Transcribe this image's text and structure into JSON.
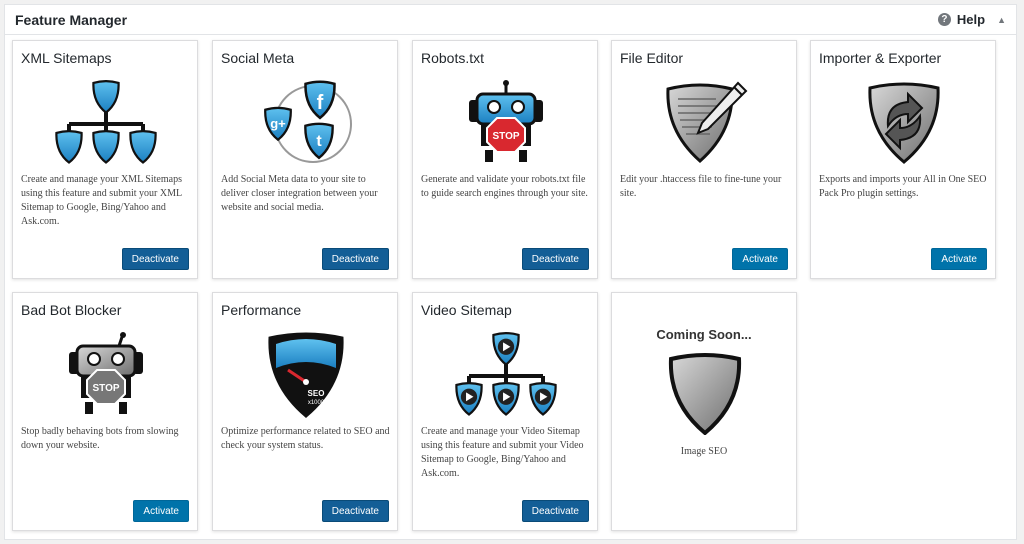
{
  "header": {
    "title": "Feature Manager",
    "help_label": "Help",
    "help_icon_glyph": "?",
    "collapse_glyph": "▲"
  },
  "cards": [
    {
      "title": "XML Sitemaps",
      "icon": "sitemap-icon",
      "description": "Create and manage your XML Sitemaps using this feature and submit your XML Sitemap to Google, Bing/Yahoo and Ask.com.",
      "button": "Deactivate"
    },
    {
      "title": "Social Meta",
      "icon": "social-meta-icon",
      "description": "Add Social Meta data to your site to deliver closer integration between your website and social media.",
      "button": "Deactivate"
    },
    {
      "title": "Robots.txt",
      "icon": "robot-icon",
      "description": "Generate and validate your robots.txt file to guide search engines through your site.",
      "button": "Deactivate",
      "icon_text": "STOP"
    },
    {
      "title": "File Editor",
      "icon": "file-editor-icon",
      "description": "Edit your .htaccess file to fine-tune your site.",
      "button": "Activate"
    },
    {
      "title": "Importer & Exporter",
      "icon": "import-export-icon",
      "description": "Exports and imports your All in One SEO Pack Pro plugin settings.",
      "button": "Activate"
    },
    {
      "title": "Bad Bot Blocker",
      "icon": "bad-bot-icon",
      "description": "Stop badly behaving bots from slowing down your website.",
      "button": "Activate",
      "icon_text": "STOP"
    },
    {
      "title": "Performance",
      "icon": "performance-gauge-icon",
      "description": "Optimize performance related to SEO and check your system status.",
      "button": "Deactivate",
      "icon_text": "SEO",
      "icon_subtext": "x1000"
    },
    {
      "title": "Video Sitemap",
      "icon": "video-sitemap-icon",
      "description": "Create and manage your Video Sitemap using this feature and submit your Video Sitemap to Google, Bing/Yahoo and Ask.com.",
      "button": "Deactivate"
    }
  ],
  "coming_soon": {
    "title": "Coming Soon...",
    "subtitle": "Image SEO",
    "icon": "shield-icon"
  },
  "colors": {
    "activate": "#0073aa",
    "deactivate": "#135e96",
    "icon_blue": "#3aa0d8"
  }
}
